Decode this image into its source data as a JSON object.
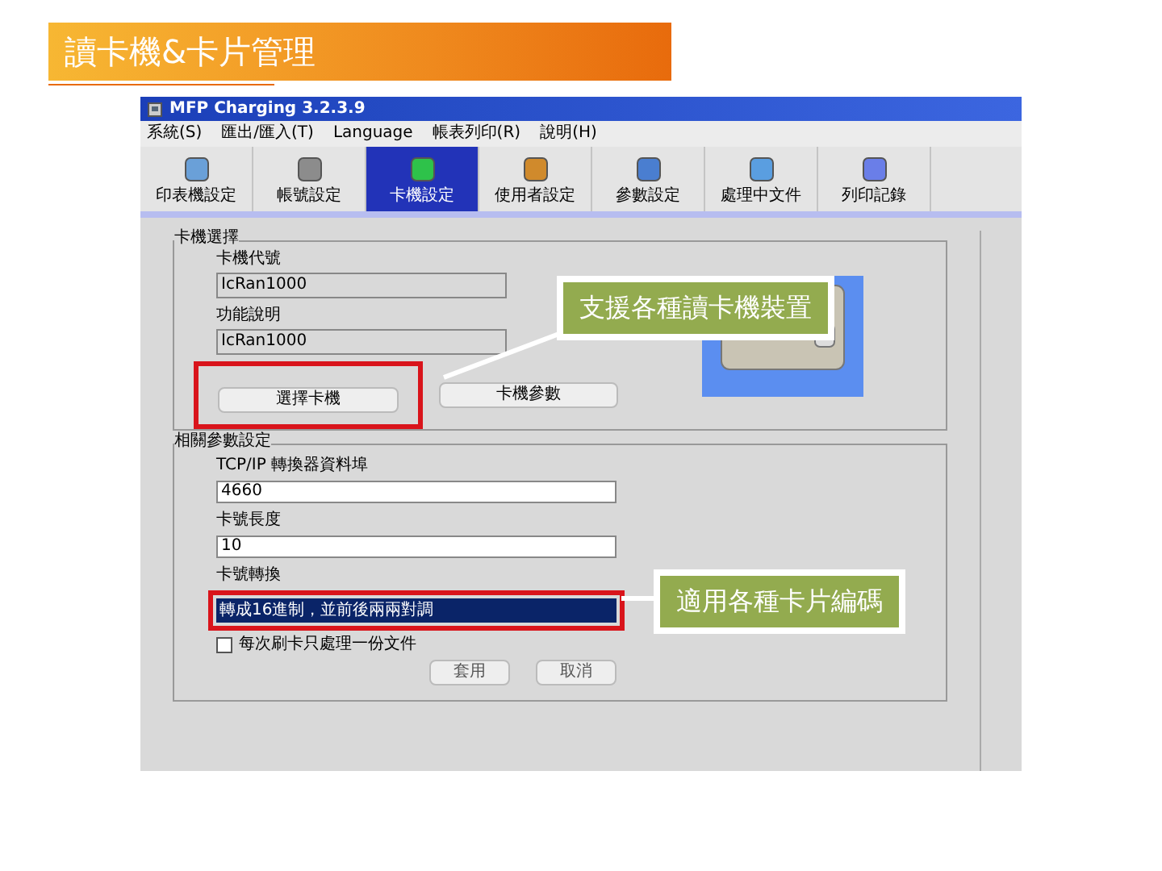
{
  "slide_title": "讀卡機&卡片管理",
  "window": {
    "title": "MFP Charging 3.2.3.9"
  },
  "menu": [
    "系統(S)",
    "匯出/匯入(T)",
    "Language",
    "帳表列印(R)",
    "說明(H)"
  ],
  "toolbar": [
    {
      "label": "印表機設定",
      "selected": false
    },
    {
      "label": "帳號設定",
      "selected": false
    },
    {
      "label": "卡機設定",
      "selected": true
    },
    {
      "label": "使用者設定",
      "selected": false
    },
    {
      "label": "參數設定",
      "selected": false
    },
    {
      "label": "處理中文件",
      "selected": false
    },
    {
      "label": "列印記錄",
      "selected": false
    }
  ],
  "reader_group": {
    "title": "卡機選擇",
    "fields": [
      {
        "label": "卡機代號",
        "value": "IcRan1000"
      },
      {
        "label": "功能說明",
        "value": "IcRan1000"
      }
    ],
    "buttons": [
      "選擇卡機",
      "卡機參數"
    ]
  },
  "params_group": {
    "title": "相關參數設定",
    "fields": [
      {
        "label": "TCP/IP 轉換器資料埠",
        "value": "4660"
      },
      {
        "label": "卡號長度",
        "value": "10"
      }
    ],
    "conversion": {
      "label": "卡號轉換",
      "value": "轉成16進制，並前後兩兩對調"
    },
    "checkbox": {
      "label": "每次刷卡只處理一份文件",
      "checked": false
    },
    "buttons": [
      "套用",
      "取消"
    ]
  },
  "callouts": [
    "支援各種讀卡機裝置",
    "適用各種卡片編碼"
  ]
}
